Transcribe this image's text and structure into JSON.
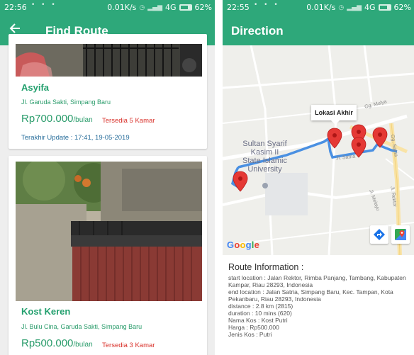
{
  "left_phone": {
    "status": {
      "time": "22:56",
      "dots": "• • •",
      "speed": "0.01K/s",
      "network": "4G",
      "battery": "62%"
    },
    "appbar": {
      "back_icon": "arrow-left-icon",
      "title": "Find Route"
    },
    "listings": [
      {
        "name": "Asyifa",
        "address": "Jl. Garuda Sakti, Simpang Baru",
        "price": "Rp700.000",
        "price_unit": "/bulan",
        "availability": "Tersedia 5 Kamar",
        "last_update": "Terakhir Update : 17:41, 19-05-2019"
      },
      {
        "name": "Kost Keren",
        "address": "Jl. Bulu Cina, Garuda Sakti, Simpang Baru",
        "price": "Rp500.000",
        "price_unit": "/bulan",
        "availability": "Tersedia 3 Kamar"
      }
    ]
  },
  "right_phone": {
    "status": {
      "time": "22:55",
      "dots": "• • •",
      "speed": "0.01K/s",
      "network": "4G",
      "battery": "62%"
    },
    "appbar": {
      "title": "Direction"
    },
    "map": {
      "callout": "Lokasi Akhir",
      "place_label": "Sultan Syarif\nKasim II\nState Islamic\nUniversity",
      "street_labels": [
        "Gg. Mulya",
        "Jl. Satria",
        "Gg. Satria",
        "Jl. Melayu",
        "Jl. Rektor"
      ],
      "google_logo": {
        "g": "G",
        "o1": "o",
        "o2": "o",
        "g2": "g",
        "l": "l",
        "e": "e"
      },
      "buttons": [
        "directions-icon",
        "maps-app-icon"
      ],
      "route_color": "#4a90e2",
      "marker_color": "#e53935"
    },
    "route_info": {
      "heading": "Route Information :",
      "start_location": "start location : Jalan Rektor, Rimba Panjang, Tambang, Kabupaten Kampar, Riau 28293, Indonesia",
      "end_location": "end location : Jalan Satria, Simpang Baru, Kec. Tampan, Kota Pekanbaru, Riau 28293, Indonesia",
      "distance": "distance : 2.8 km (2815)",
      "duration": "duration : 10 mins (620)",
      "nama_kos": "Nama Kos : Kost Putri",
      "harga": "Harga : Rp500.000",
      "jenis_kos": "Jenis Kos : Putri"
    }
  },
  "colors": {
    "primary": "#2ea87a",
    "price_green": "#2a9c6b",
    "availability_red": "#d9322b",
    "update_blue": "#2a6f9c"
  }
}
